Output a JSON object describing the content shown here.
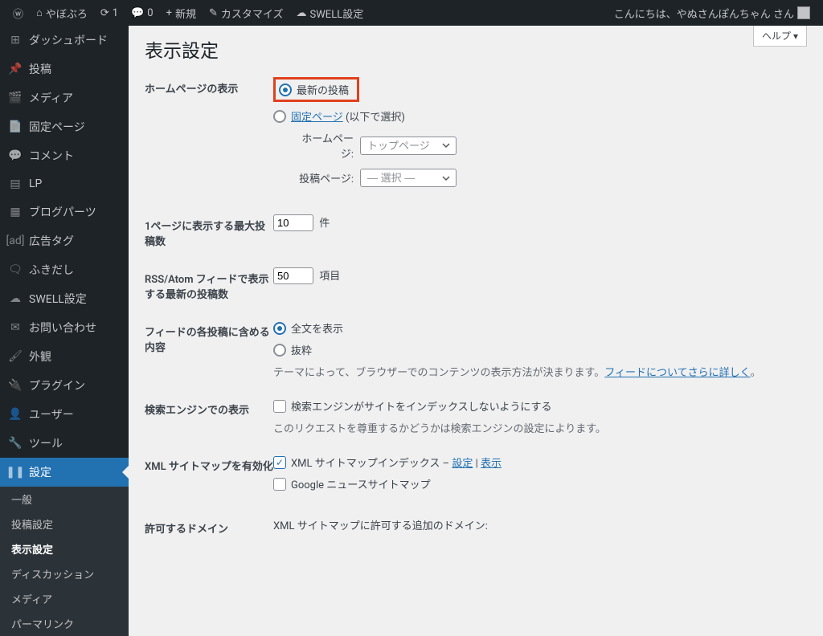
{
  "toolbar": {
    "site_name": "やぼぶろ",
    "updates_count": "1",
    "comments_count": "0",
    "new_label": "新規",
    "customize_label": "カスタマイズ",
    "swell_label": "SWELL設定",
    "greeting": "こんにちは、やぬさんぽんちゃん さん"
  },
  "sidebar": {
    "items": [
      {
        "label": "ダッシュボード",
        "icon": "dashboard"
      },
      {
        "label": "投稿",
        "icon": "pin"
      },
      {
        "label": "メディア",
        "icon": "media"
      },
      {
        "label": "固定ページ",
        "icon": "page"
      },
      {
        "label": "コメント",
        "icon": "comment"
      },
      {
        "label": "LP",
        "icon": "lp"
      },
      {
        "label": "ブログパーツ",
        "icon": "parts"
      },
      {
        "label": "広告タグ",
        "icon": "ad"
      },
      {
        "label": "ふきだし",
        "icon": "bubble"
      },
      {
        "label": "SWELL設定",
        "icon": "swell"
      },
      {
        "label": "お問い合わせ",
        "icon": "mail"
      },
      {
        "label": "外観",
        "icon": "brush"
      },
      {
        "label": "プラグイン",
        "icon": "plugin"
      },
      {
        "label": "ユーザー",
        "icon": "user"
      },
      {
        "label": "ツール",
        "icon": "tool"
      },
      {
        "label": "設定",
        "icon": "settings"
      }
    ],
    "sub": [
      "一般",
      "投稿設定",
      "表示設定",
      "ディスカッション",
      "メディア",
      "パーマリンク"
    ],
    "current_sub": 2
  },
  "page": {
    "title": "表示設定",
    "help": "ヘルプ ▾"
  },
  "settings": {
    "homepage_display": {
      "label": "ホームページの表示",
      "latest_posts": "最新の投稿",
      "static_page": "固定ページ",
      "static_suffix": " (以下で選択)",
      "homepage_label": "ホームページ:",
      "post_page_label": "投稿ページ:",
      "homepage_value": "トップページ",
      "post_page_value": "— 選択 —"
    },
    "posts_per_page": {
      "label": "1ページに表示する最大投稿数",
      "value": "10",
      "suffix": "件"
    },
    "feed_items": {
      "label": "RSS/Atom フィードで表示する最新の投稿数",
      "value": "50",
      "suffix": "項目"
    },
    "feed_content": {
      "label": "フィードの各投稿に含める内容",
      "full": "全文を表示",
      "summary": "抜粋",
      "desc_pre": "テーマによって、ブラウザーでのコンテンツの表示方法が決まります。",
      "link": "フィードについてさらに詳しく",
      "desc_post": "。"
    },
    "search_engines": {
      "label": "検索エンジンでの表示",
      "check_label": "検索エンジンがサイトをインデックスしないようにする",
      "desc": "このリクエストを尊重するかどうかは検索エンジンの設定によります。"
    },
    "sitemap": {
      "label": "XML サイトマップを有効化",
      "index_label": "XML サイトマップインデックス  –  ",
      "link1": "設定",
      "sep": " | ",
      "link2": "表示",
      "news_label": "Google ニュースサイトマップ"
    },
    "domain": {
      "label": "許可するドメイン",
      "desc": "XML サイトマップに許可する追加のドメイン:"
    }
  }
}
